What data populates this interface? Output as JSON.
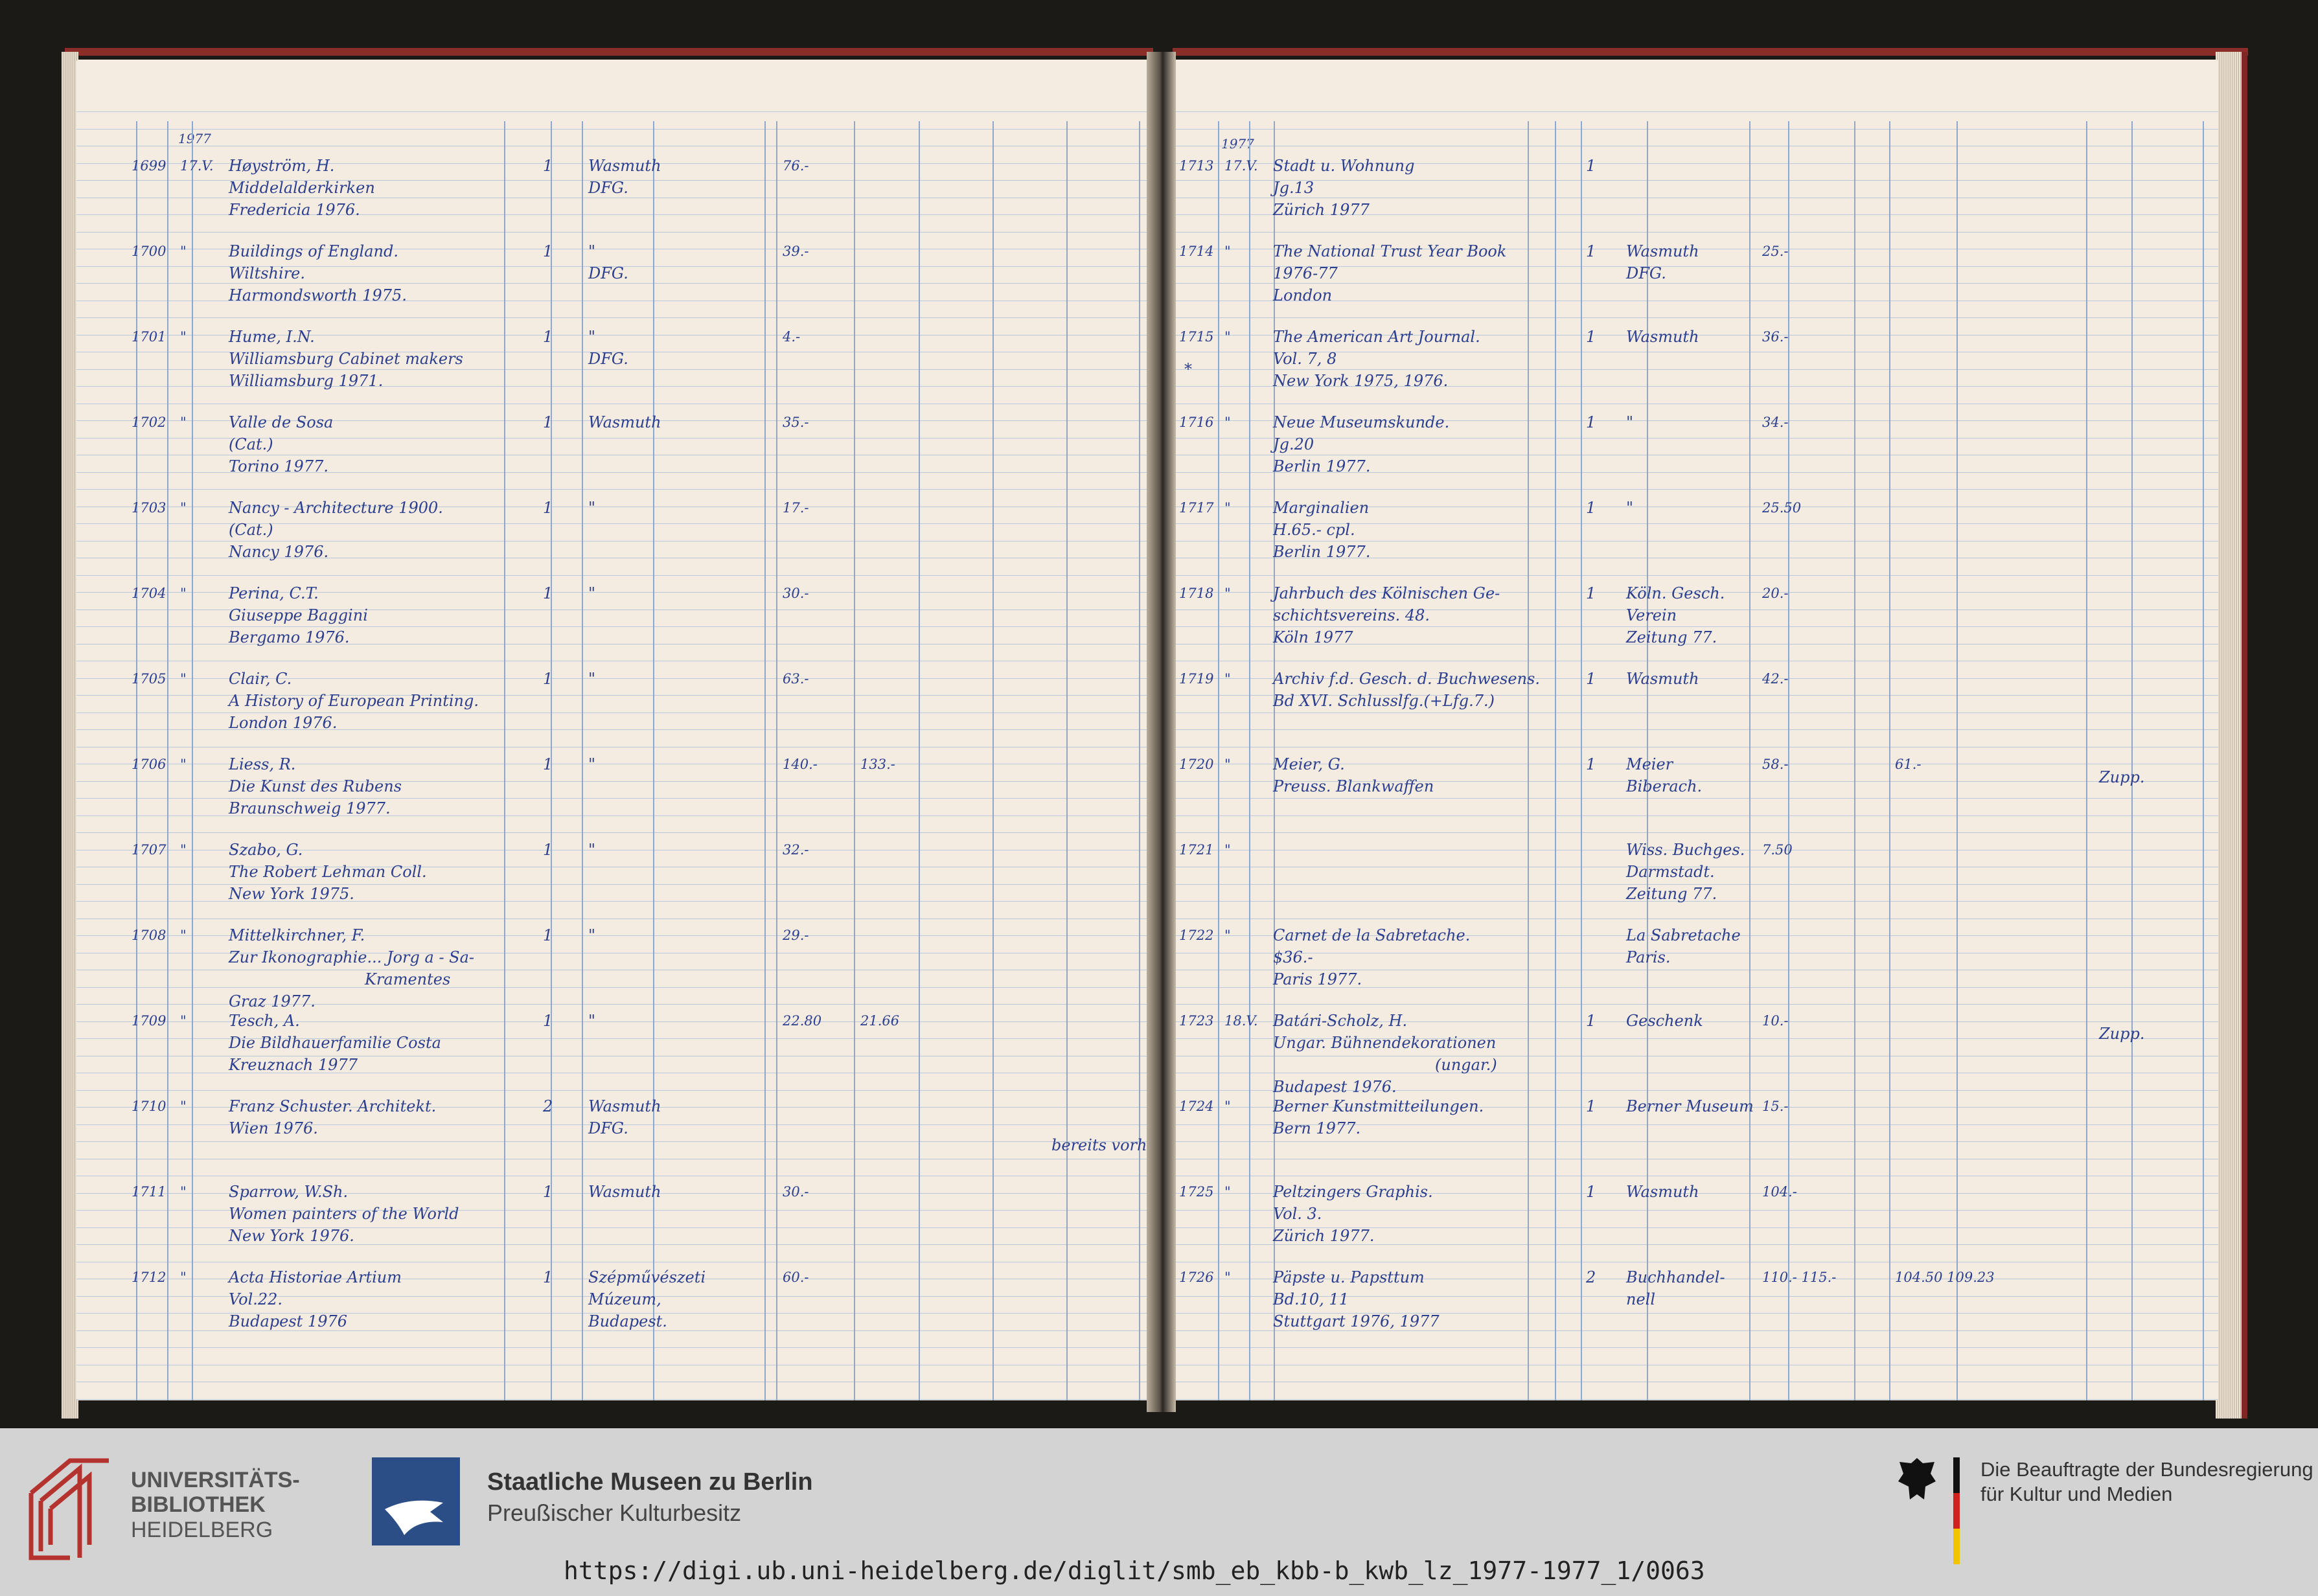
{
  "header": {
    "year_left": "1977",
    "year_right": "1977"
  },
  "left_entries": [
    {
      "no": "1699",
      "date": "17.V.",
      "lines": [
        "Høyström, H.",
        "Middelalderkirken",
        "Fredericia 1976."
      ],
      "qty": "1",
      "dealer": [
        "Wasmuth",
        "DFG."
      ],
      "price": "76.-",
      "price2": ""
    },
    {
      "no": "1700",
      "date": "\"",
      "lines": [
        "Buildings of England.",
        "Wiltshire.",
        "Harmondsworth 1975."
      ],
      "qty": "1",
      "dealer": [
        "\"",
        "DFG."
      ],
      "price": "39.-",
      "price2": ""
    },
    {
      "no": "1701",
      "date": "\"",
      "lines": [
        "Hume, I.N.",
        "Williamsburg Cabinet makers",
        "Williamsburg 1971."
      ],
      "qty": "1",
      "dealer": [
        "\"",
        "DFG."
      ],
      "price": "4.-",
      "price2": ""
    },
    {
      "no": "1702",
      "date": "\"",
      "lines": [
        "Valle de Sosa",
        "(Cat.)",
        "Torino 1977."
      ],
      "qty": "1",
      "dealer": [
        "Wasmuth"
      ],
      "price": "35.-",
      "price2": ""
    },
    {
      "no": "1703",
      "date": "\"",
      "lines": [
        "Nancy - Architecture 1900.",
        "(Cat.)",
        "Nancy 1976."
      ],
      "qty": "1",
      "dealer": [
        "\""
      ],
      "price": "17.-",
      "price2": ""
    },
    {
      "no": "1704",
      "date": "\"",
      "lines": [
        "Perina, C.T.",
        "Giuseppe Baggini",
        "Bergamo 1976."
      ],
      "qty": "1",
      "dealer": [
        "\""
      ],
      "price": "30.-",
      "price2": ""
    },
    {
      "no": "1705",
      "date": "\"",
      "lines": [
        "Clair, C.",
        "A History of European Printing.",
        "London 1976."
      ],
      "qty": "1",
      "dealer": [
        "\""
      ],
      "price": "63.-",
      "price2": ""
    },
    {
      "no": "1706",
      "date": "\"",
      "lines": [
        "Liess, R.",
        "Die Kunst des Rubens",
        "Braunschweig 1977."
      ],
      "qty": "1",
      "dealer": [
        "\""
      ],
      "price": "140.-",
      "price2": "133.-"
    },
    {
      "no": "1707",
      "date": "\"",
      "lines": [
        "Szabo, G.",
        "The Robert Lehman Coll.",
        "New York 1975."
      ],
      "qty": "1",
      "dealer": [
        "\""
      ],
      "price": "32.-",
      "price2": ""
    },
    {
      "no": "1708",
      "date": "\"",
      "lines": [
        "Mittelkirchner, F.",
        "Zur Ikonographie... Jorg a - Sa-",
        "Kramentes",
        "Graz 1977."
      ],
      "qty": "1",
      "dealer": [
        "\""
      ],
      "price": "29.-",
      "price2": ""
    },
    {
      "no": "1709",
      "date": "\"",
      "lines": [
        "Tesch, A.",
        "Die Bildhauerfamilie Costa",
        "Kreuznach 1977"
      ],
      "qty": "1",
      "dealer": [
        "\""
      ],
      "price": "22.80",
      "price2": "21.66"
    },
    {
      "no": "1710",
      "date": "\"",
      "lines": [
        "Franz Schuster. Architekt.",
        "Wien 1976."
      ],
      "qty": "2",
      "dealer": [
        "Wasmuth",
        "DFG."
      ],
      "price": "",
      "price2": "",
      "note": "bereits vorh."
    },
    {
      "no": "1711",
      "date": "\"",
      "lines": [
        "Sparrow, W.Sh.",
        "Women painters of the World",
        "New York 1976."
      ],
      "qty": "1",
      "dealer": [
        "Wasmuth"
      ],
      "price": "30.-",
      "price2": ""
    },
    {
      "no": "1712",
      "date": "\"",
      "lines": [
        "Acta Historiae Artium",
        "Vol.22.",
        "Budapest 1976"
      ],
      "qty": "1",
      "dealer": [
        "Szépművészeti",
        "Múzeum,",
        "Budapest."
      ],
      "price": "60.-",
      "price2": ""
    }
  ],
  "right_entries": [
    {
      "no": "1713",
      "date": "17.V.",
      "lines": [
        "Stadt u. Wohnung",
        "Jg.13",
        "Zürich 1977"
      ],
      "qty": "1",
      "dealer": [
        ""
      ],
      "price": "",
      "price2": ""
    },
    {
      "no": "1714",
      "date": "\"",
      "lines": [
        "The National Trust Year Book",
        "1976-77",
        "London"
      ],
      "qty": "1",
      "dealer": [
        "Wasmuth",
        "DFG."
      ],
      "price": "25.-",
      "price2": ""
    },
    {
      "no": "1715",
      "date": "\"",
      "lines": [
        "The American Art Journal.",
        "Vol. 7, 8",
        "New York 1975, 1976."
      ],
      "qty": "1",
      "dealer": [
        "Wasmuth"
      ],
      "price": "36.-",
      "price2": "",
      "mark": "*"
    },
    {
      "no": "1716",
      "date": "\"",
      "lines": [
        "Neue Museumskunde.",
        "Jg.20",
        "Berlin 1977."
      ],
      "qty": "1",
      "dealer": [
        "\""
      ],
      "price": "34.-",
      "price2": ""
    },
    {
      "no": "1717",
      "date": "\"",
      "lines": [
        "Marginalien",
        "H.65.- cpl.",
        "Berlin 1977."
      ],
      "qty": "1",
      "dealer": [
        "\""
      ],
      "price": "25.50",
      "price2": ""
    },
    {
      "no": "1718",
      "date": "\"",
      "lines": [
        "Jahrbuch des Kölnischen Ge-",
        "schichtsvereins. 48.",
        "Köln 1977"
      ],
      "qty": "1",
      "dealer": [
        "Köln. Gesch.",
        "Verein",
        "Zeitung 77."
      ],
      "price": "20.-",
      "price2": ""
    },
    {
      "no": "1719",
      "date": "\"",
      "lines": [
        "Archiv f.d. Gesch. d. Buchwesens.",
        "Bd XVI. Schlusslfg.(+Lfg.7.)"
      ],
      "qty": "1",
      "dealer": [
        "Wasmuth"
      ],
      "price": "42.-",
      "price2": ""
    },
    {
      "no": "1720",
      "date": "\"",
      "lines": [
        "Meier, G.",
        "Preuss. Blankwaffen"
      ],
      "qty": "1",
      "dealer": [
        "Meier",
        "Biberach."
      ],
      "price": "58.-",
      "price2": "61.-",
      "note": "Zupp."
    },
    {
      "no": "1721",
      "date": "\"",
      "lines": [
        ""
      ],
      "qty": "",
      "dealer": [
        "Wiss. Buchges.",
        "Darmstadt.",
        "Zeitung 77."
      ],
      "price": "7.50",
      "price2": ""
    },
    {
      "no": "1722",
      "date": "\"",
      "lines": [
        "Carnet de la Sabretache.",
        "$36.-",
        "Paris 1977."
      ],
      "qty": "",
      "dealer": [
        "La Sabretache",
        "Paris."
      ],
      "price": "",
      "price2": ""
    },
    {
      "no": "1723",
      "date": "18.V.",
      "lines": [
        "Batári-Scholz, H.",
        "Ungar. Bühnendekorationen",
        "(ungar.)",
        "Budapest 1976."
      ],
      "qty": "1",
      "dealer": [
        "Geschenk"
      ],
      "price": "10.-",
      "price2": "",
      "note": "Zupp."
    },
    {
      "no": "1724",
      "date": "\"",
      "lines": [
        "Berner Kunstmitteilungen.",
        "Bern 1977."
      ],
      "qty": "1",
      "dealer": [
        "Berner Museum"
      ],
      "price": "15.-",
      "price2": ""
    },
    {
      "no": "1725",
      "date": "\"",
      "lines": [
        "Peltzingers Graphis.",
        "Vol. 3.",
        "Zürich 1977."
      ],
      "qty": "1",
      "dealer": [
        "Wasmuth"
      ],
      "price": "104.-",
      "price2": ""
    },
    {
      "no": "1726",
      "date": "\"",
      "lines": [
        "Päpste u. Papsttum",
        "Bd.10, 11",
        "Stuttgart 1976, 1977"
      ],
      "qty": "2",
      "dealer": [
        "Buchhandel-",
        "nell"
      ],
      "price": "110.- 115.-",
      "price2": "104.50 109.23"
    }
  ],
  "footer": {
    "ub_line1": "UNIVERSITÄTS-",
    "ub_line2": "BIBLIOTHEK",
    "ub_line3": "HEIDELBERG",
    "smb_title": "Staatliche Museen zu Berlin",
    "smb_sub": "Preußischer Kulturbesitz",
    "bkm_line1": "Die Beauftragte der Bundesregierung",
    "bkm_line2": "für Kultur und Medien",
    "url": "https://digi.ub.uni-heidelberg.de/diglit/smb_eb_kbb-b_kwb_lz_1977-1977_1/0063"
  },
  "colors": {
    "ink": "#2d3f8f",
    "paper": "#f4ece0",
    "ub_red": "#b5332f",
    "smb_blue": "#2b4e86"
  }
}
